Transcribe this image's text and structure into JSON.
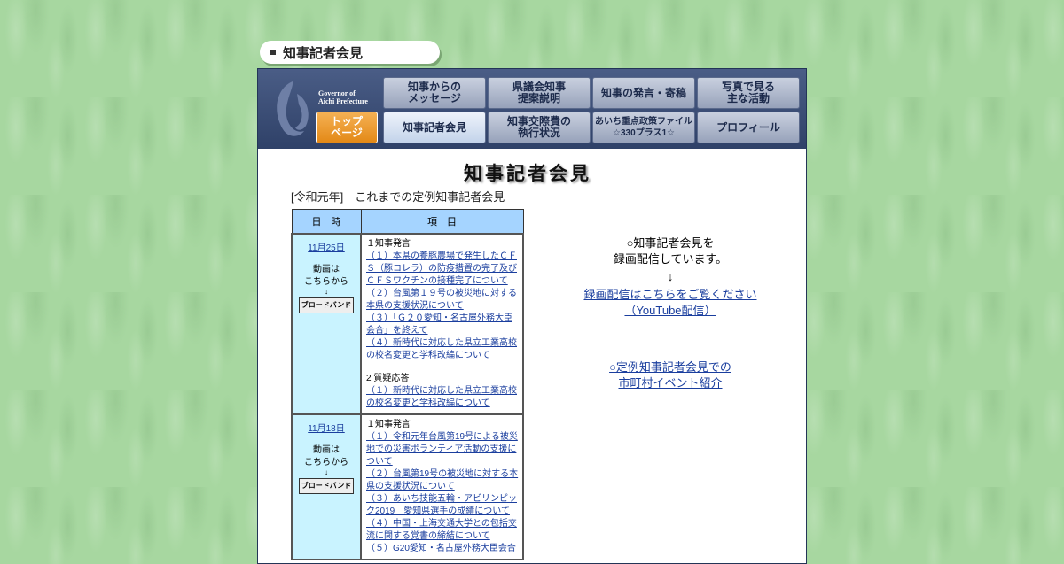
{
  "page_title": "知事記者会見",
  "nav": {
    "logo_text": "Governor of\nAichi Prefecture",
    "logo_line1": "Governor of",
    "logo_line2": "Aichi Prefecture",
    "top": "トップ\nページ",
    "top_l1": "トップ",
    "top_l2": "ページ",
    "b1_l1": "知事からの",
    "b1_l2": "メッセージ",
    "b2_l1": "県議会知事",
    "b2_l2": "提案説明",
    "b3": "知事の発言・寄稿",
    "b4_l1": "写真で見る",
    "b4_l2": "主な活動",
    "b5": "知事記者会見",
    "b6_l1": "知事交際費の",
    "b6_l2": "執行状況",
    "b7_l1": "あいち重点政策ファイル",
    "b7_l2": "☆330プラス1☆",
    "b8": "プロフィール"
  },
  "main": {
    "heading": "知事記者会見",
    "subheading": "[令和元年]　これまでの定例知事記者会見",
    "table": {
      "col_date": "日　時",
      "col_items": "項　目",
      "video_l1": "動画は",
      "video_l2": "こちらから",
      "arrow": "↓",
      "bb": "ブロードバンド",
      "rows": [
        {
          "date": "11月25日",
          "sec1": "１知事発言",
          "links1": [
            "（１）本県の養豚農場で発生したＣＦＳ（豚コレラ）の防疫措置の完了及びＣＦＳワクチンの接種完了について",
            "（２）台風第１９号の被災地に対する本県の支援状況について",
            "（３）「Ｇ２０愛知・名古屋外務大臣会合」を終えて",
            "（４）新時代に対応した県立工業高校の校名変更と学科改編について"
          ],
          "sec2": "2 質疑応答",
          "links2": [
            "（１）新時代に対応した県立工業高校の校名変更と学科改編について"
          ]
        },
        {
          "date": "11月18日",
          "sec1": "１知事発言",
          "links1": [
            "（１）令和元年台風第19号による被災地での災害ボランティア活動の支援について",
            "（２）台風第19号の被災地に対する本県の支援状況について",
            "（３）あいち技能五輪・アビリンピック2019　愛知県選手の成績について",
            "（４）中国・上海交通大学との包括交流に関する覚書の締結について",
            "（５）G20愛知・名古屋外務大臣会合"
          ]
        }
      ]
    },
    "right": {
      "rec_l1": "○知事記者会見を",
      "rec_l2": "録画配信しています。",
      "arrow": "↓",
      "link_l1": "録画配信はこちらをご覧ください",
      "link_l2": "（YouTube配信）",
      "event_l1": "○定例知事記者会見での",
      "event_l2": "市町村イベント紹介"
    }
  }
}
